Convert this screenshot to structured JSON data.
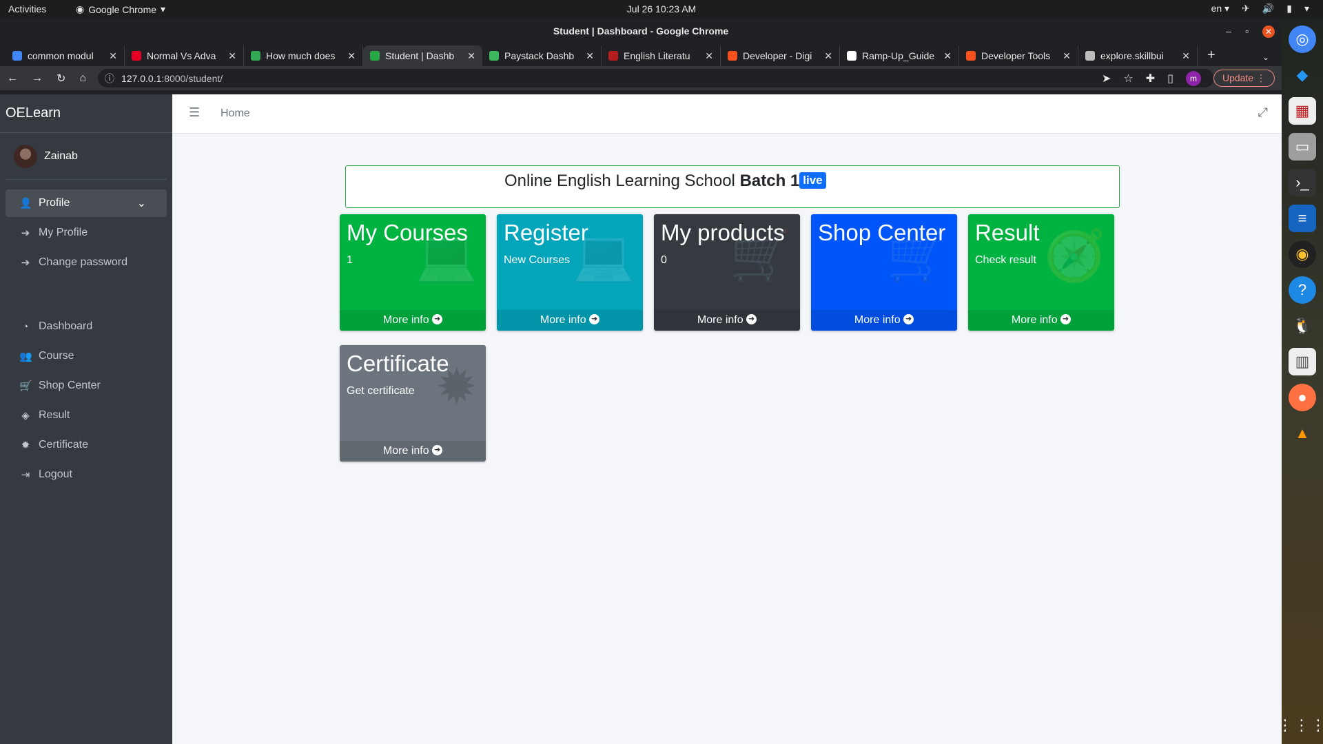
{
  "system": {
    "activities": "Activities",
    "app_name": "Google Chrome",
    "clock": "Jul 26  10:23 AM",
    "lang": "en"
  },
  "window": {
    "title": "Student | Dashboard - Google Chrome"
  },
  "tabs": [
    {
      "title": "common modul",
      "color": "#4285f4"
    },
    {
      "title": "Normal Vs Adva",
      "color": "#e60023"
    },
    {
      "title": "How much does",
      "color": "#34a853"
    },
    {
      "title": "Student | Dashb",
      "color": "#28a745"
    },
    {
      "title": "Paystack Dashb",
      "color": "#3bb75e"
    },
    {
      "title": "English Literatu",
      "color": "#b71c1c"
    },
    {
      "title": "Developer - Digi",
      "color": "#f4511e"
    },
    {
      "title": "Ramp-Up_Guide",
      "color": "#ffffff"
    },
    {
      "title": "Developer Tools",
      "color": "#f4511e"
    },
    {
      "title": "explore.skillbui",
      "color": "#bdbdbd"
    }
  ],
  "address_bar": {
    "host": "127.0.0.1",
    "path": ":8000/student/"
  },
  "toolbar": {
    "profile_initial": "m",
    "update_label": "Update"
  },
  "sidebar": {
    "brand": "OELearn",
    "user_name": "Zainab",
    "profile_menu": "Profile",
    "profile_items": [
      "My Profile",
      "Change password"
    ],
    "items": [
      "Dashboard",
      "Course",
      "Shop Center",
      "Result",
      "Certificate",
      "Logout"
    ]
  },
  "header": {
    "home": "Home"
  },
  "banner": {
    "text": "Online English Learning School ",
    "bold": "Batch 1",
    "badge": "live"
  },
  "cards": [
    {
      "title": "My Courses",
      "sub": "1",
      "footer": "More info",
      "color": "#00b341",
      "icon": "laptop-icon"
    },
    {
      "title": "Register",
      "sub": "New Courses",
      "footer": "More info",
      "color": "#03a5bb",
      "icon": "laptop-icon"
    },
    {
      "title": "My products",
      "sub": "0",
      "footer": "More info",
      "color": "#343a40",
      "icon": "cart-icon"
    },
    {
      "title": "Shop Center",
      "sub": "",
      "footer": "More info",
      "color": "#0055f9",
      "icon": "cart-icon"
    },
    {
      "title": "Result",
      "sub": "Check result",
      "footer": "More info",
      "color": "#00b341",
      "icon": "compass-icon"
    },
    {
      "title": "Certificate",
      "sub": "Get certificate",
      "footer": "More info",
      "color": "#6c757d",
      "icon": "certificate-icon"
    }
  ]
}
